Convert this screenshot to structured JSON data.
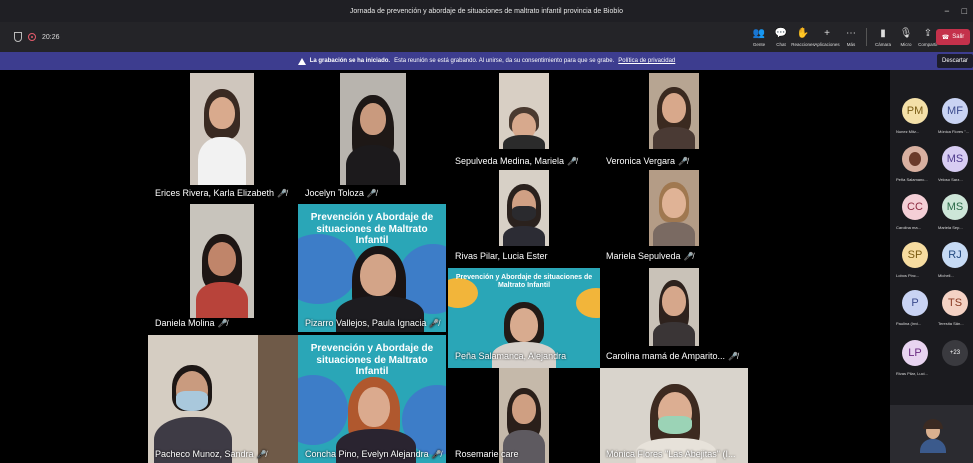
{
  "window": {
    "title": "Jornada de prevención y abordaje de situaciones de maltrato infantil provincia de Biobío",
    "minimize": "−",
    "maximize": "□"
  },
  "toolbar": {
    "timer": "20:26",
    "buttons": [
      {
        "label": "Gente",
        "icon": "people-icon"
      },
      {
        "label": "Chat",
        "icon": "chat-icon"
      },
      {
        "label": "Reacciones",
        "icon": "reactions-icon"
      },
      {
        "label": "Aplicaciones",
        "icon": "apps-icon"
      },
      {
        "label": "Más",
        "icon": "more-icon"
      },
      {
        "label": "Cámara",
        "icon": "camera-icon"
      },
      {
        "label": "Micro",
        "icon": "mic-icon"
      },
      {
        "label": "Compartir",
        "icon": "share-icon"
      }
    ],
    "leave": "Salir"
  },
  "banner": {
    "bold": "La grabación se ha iniciado.",
    "text": "Esta reunión se está grabando. Al unirse, da su consentimiento para que se grabe.",
    "link": "Política de privacidad",
    "dismiss": "Descartar"
  },
  "participants": [
    {
      "name": "Erices Rivera, Karla Elizabeth"
    },
    {
      "name": "Jocelyn Toloza"
    },
    {
      "name": "Sepulveda Medina, Mariela"
    },
    {
      "name": "Veronica Vergara"
    },
    {
      "name": "Rivas Pilar, Lucia Ester"
    },
    {
      "name": "Mariela Sepulveda"
    },
    {
      "name": "Daniela Molina"
    },
    {
      "name": "Pizarro Vallejos, Paula Ignacia"
    },
    {
      "name": "Peña Salamanca, Alejandra"
    },
    {
      "name": "Carolina mamá de Amparito..."
    },
    {
      "name": "Pacheco Munoz, Sandra"
    },
    {
      "name": "Concha Pino, Evelyn Alejandra"
    },
    {
      "name": "Rosemarie care"
    },
    {
      "name": "Mónica Flores \"Las Abejitas\" (I..."
    }
  ],
  "backgrounds": {
    "large": "Prevención y Abordaje de situaciones de Maltrato Infantil",
    "small": "Prevención y Abordaje de situaciones de Maltrato Infantil"
  },
  "sidebar": {
    "people": [
      {
        "initials": "PM",
        "name": "Nunez Mitz..."
      },
      {
        "initials": "MF",
        "name": "Mónica Flores \"..."
      },
      {
        "initials": "",
        "name": "Peña Salamanc..."
      },
      {
        "initials": "MS",
        "name": "Veloso Sarz..."
      },
      {
        "initials": "CC",
        "name": "Carolina ma..."
      },
      {
        "initials": "MS",
        "name": "Mariela Sep..."
      },
      {
        "initials": "SP",
        "name": "Lobos Pinc..."
      },
      {
        "initials": "RJ",
        "name": "Michell..."
      },
      {
        "initials": "P",
        "name": "Paulina (Invi..."
      },
      {
        "initials": "TS",
        "name": "Teresita Sän..."
      },
      {
        "initials": "LP",
        "name": "Rivas Pilar, Luci..."
      }
    ],
    "more": "+23"
  },
  "colors": {
    "teams_purple": "#464eb8",
    "leave_red": "#c4314b",
    "bg_teal": "#2aa6b7",
    "bg_blue": "#4a6fc4"
  }
}
